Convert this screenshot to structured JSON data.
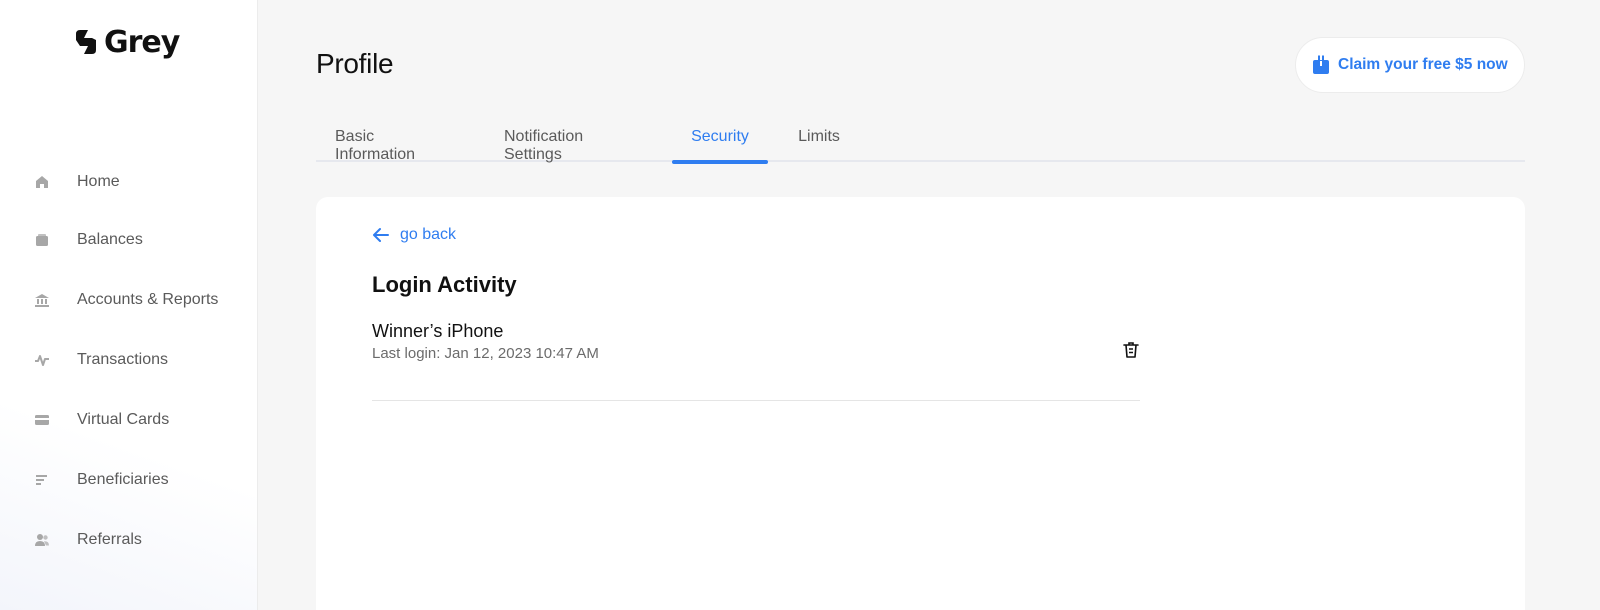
{
  "brand": {
    "name": "Grey",
    "accent": "#2f7df0"
  },
  "sidebar": {
    "items": [
      {
        "label": "Home",
        "icon": "home-icon"
      },
      {
        "label": "Balances",
        "icon": "wallet-icon"
      },
      {
        "label": "Accounts & Reports",
        "icon": "bank-icon"
      },
      {
        "label": "Transactions",
        "icon": "activity-icon"
      },
      {
        "label": "Virtual Cards",
        "icon": "card-icon"
      },
      {
        "label": "Beneficiaries",
        "icon": "list-icon"
      },
      {
        "label": "Referrals",
        "icon": "users-icon"
      }
    ]
  },
  "header": {
    "title": "Profile",
    "promo_label": "Claim your free $5 now",
    "promo_icon": "gift-icon"
  },
  "tabs": [
    {
      "label": "Basic Information",
      "active": false
    },
    {
      "label": "Notification Settings",
      "active": false
    },
    {
      "label": "Security",
      "active": true
    },
    {
      "label": "Limits",
      "active": false
    }
  ],
  "content": {
    "back_label": "go back",
    "section_title": "Login Activity",
    "devices": [
      {
        "name": "Winner’s iPhone",
        "last_login": "Last login: Jan 12, 2023 10:47 AM",
        "action_icon": "trash-icon"
      }
    ]
  }
}
